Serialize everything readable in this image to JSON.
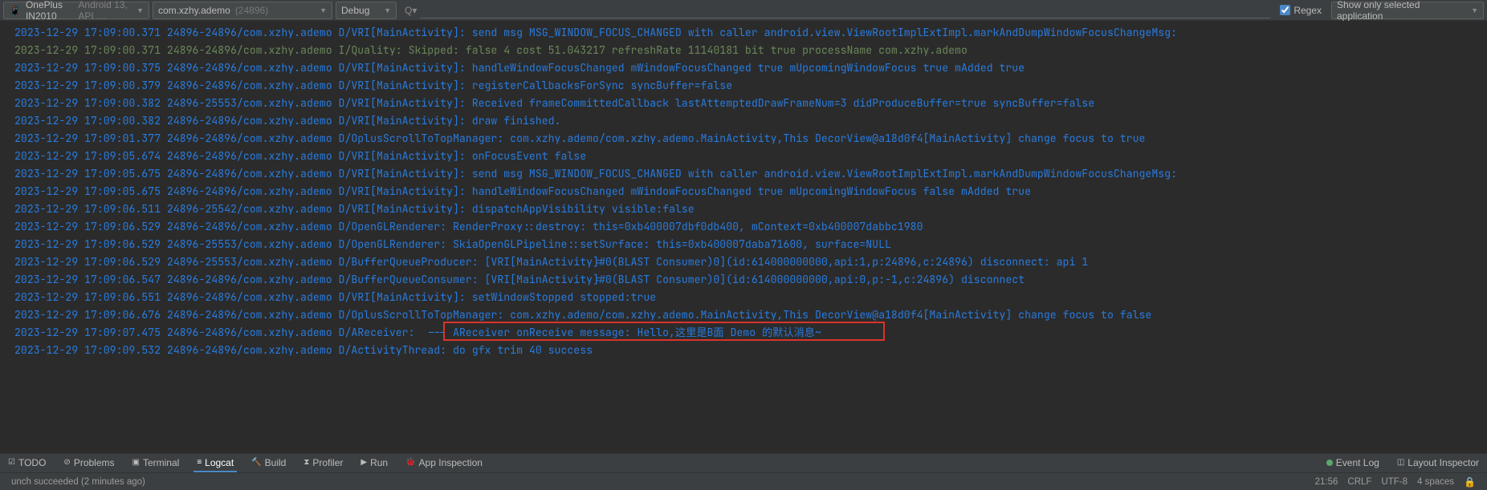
{
  "toolbar": {
    "device": {
      "main": "OnePlus IN2010",
      "extra": "Android 13, API …"
    },
    "process": {
      "main": "com.xzhy.ademo",
      "pid": "(24896)"
    },
    "level": "Debug",
    "search": "",
    "regex_label": "Regex",
    "regex_checked": true,
    "filter": "Show only selected application"
  },
  "logs": [
    {
      "lvl": "D",
      "ts": "2023-12-29 17:09:00.371",
      "pt": "24896-24896",
      "pkg": "com.xzhy.ademo",
      "tag": "VRI[MainActivity]",
      "msg": "send msg MSG_WINDOW_FOCUS_CHANGED with caller android.view.ViewRootImplExtImpl.markAndDumpWindowFocusChangeMsg:"
    },
    {
      "lvl": "I",
      "ts": "2023-12-29 17:09:00.371",
      "pt": "24896-24896",
      "pkg": "com.xzhy.ademo",
      "tag": "Quality",
      "msg": "Skipped: false 4 cost 51.043217 refreshRate 11140181 bit true processName com.xzhy.ademo"
    },
    {
      "lvl": "D",
      "ts": "2023-12-29 17:09:00.375",
      "pt": "24896-24896",
      "pkg": "com.xzhy.ademo",
      "tag": "VRI[MainActivity]",
      "msg": "handleWindowFocusChanged mWindowFocusChanged true mUpcomingWindowFocus true mAdded true"
    },
    {
      "lvl": "D",
      "ts": "2023-12-29 17:09:00.379",
      "pt": "24896-24896",
      "pkg": "com.xzhy.ademo",
      "tag": "VRI[MainActivity]",
      "msg": "registerCallbacksForSync syncBuffer=false"
    },
    {
      "lvl": "D",
      "ts": "2023-12-29 17:09:00.382",
      "pt": "24896-25553",
      "pkg": "com.xzhy.ademo",
      "tag": "VRI[MainActivity]",
      "msg": "Received frameCommittedCallback lastAttemptedDrawFrameNum=3 didProduceBuffer=true syncBuffer=false"
    },
    {
      "lvl": "D",
      "ts": "2023-12-29 17:09:00.382",
      "pt": "24896-24896",
      "pkg": "com.xzhy.ademo",
      "tag": "VRI[MainActivity]",
      "msg": "draw finished."
    },
    {
      "lvl": "D",
      "ts": "2023-12-29 17:09:01.377",
      "pt": "24896-24896",
      "pkg": "com.xzhy.ademo",
      "tag": "OplusScrollToTopManager",
      "msg": "com.xzhy.ademo/com.xzhy.ademo.MainActivity,This DecorView@a18d0f4[MainActivity] change focus to true"
    },
    {
      "lvl": "D",
      "ts": "2023-12-29 17:09:05.674",
      "pt": "24896-24896",
      "pkg": "com.xzhy.ademo",
      "tag": "VRI[MainActivity]",
      "msg": "onFocusEvent false"
    },
    {
      "lvl": "D",
      "ts": "2023-12-29 17:09:05.675",
      "pt": "24896-24896",
      "pkg": "com.xzhy.ademo",
      "tag": "VRI[MainActivity]",
      "msg": "send msg MSG_WINDOW_FOCUS_CHANGED with caller android.view.ViewRootImplExtImpl.markAndDumpWindowFocusChangeMsg:"
    },
    {
      "lvl": "D",
      "ts": "2023-12-29 17:09:05.675",
      "pt": "24896-24896",
      "pkg": "com.xzhy.ademo",
      "tag": "VRI[MainActivity]",
      "msg": "handleWindowFocusChanged mWindowFocusChanged true mUpcomingWindowFocus false mAdded true"
    },
    {
      "lvl": "D",
      "ts": "2023-12-29 17:09:06.511",
      "pt": "24896-25542",
      "pkg": "com.xzhy.ademo",
      "tag": "VRI[MainActivity]",
      "msg": "dispatchAppVisibility visible:false"
    },
    {
      "lvl": "D",
      "ts": "2023-12-29 17:09:06.529",
      "pt": "24896-24896",
      "pkg": "com.xzhy.ademo",
      "tag": "OpenGLRenderer",
      "msg": "RenderProxy::destroy: this=0xb400007dbf0db400, mContext=0xb400007dabbc1980"
    },
    {
      "lvl": "D",
      "ts": "2023-12-29 17:09:06.529",
      "pt": "24896-25553",
      "pkg": "com.xzhy.ademo",
      "tag": "OpenGLRenderer",
      "msg": "SkiaOpenGLPipeline::setSurface: this=0xb400007daba71600, surface=NULL"
    },
    {
      "lvl": "D",
      "ts": "2023-12-29 17:09:06.529",
      "pt": "24896-25553",
      "pkg": "com.xzhy.ademo",
      "tag": "BufferQueueProducer",
      "msg": "[VRI[MainActivity]#0(BLAST Consumer)0](id:614000000000,api:1,p:24896,c:24896) disconnect: api 1"
    },
    {
      "lvl": "D",
      "ts": "2023-12-29 17:09:06.547",
      "pt": "24896-24896",
      "pkg": "com.xzhy.ademo",
      "tag": "BufferQueueConsumer",
      "msg": "[VRI[MainActivity]#0(BLAST Consumer)0](id:614000000000,api:0,p:-1,c:24896) disconnect"
    },
    {
      "lvl": "D",
      "ts": "2023-12-29 17:09:06.551",
      "pt": "24896-24896",
      "pkg": "com.xzhy.ademo",
      "tag": "VRI[MainActivity]",
      "msg": "setWindowStopped stopped:true"
    },
    {
      "lvl": "D",
      "ts": "2023-12-29 17:09:06.676",
      "pt": "24896-24896",
      "pkg": "com.xzhy.ademo",
      "tag": "OplusScrollToTopManager",
      "msg": "com.xzhy.ademo/com.xzhy.ademo.MainActivity,This DecorView@a18d0f4[MainActivity] change focus to false"
    },
    {
      "lvl": "D",
      "ts": "2023-12-29 17:09:07.475",
      "pt": "24896-24896",
      "pkg": "com.xzhy.ademo",
      "tag": "AReceiver",
      "msg": " --- AReceiver onReceive message: Hello,这里是B面 Demo 的默认消息~",
      "hl": true
    },
    {
      "lvl": "D",
      "ts": "2023-12-29 17:09:09.532",
      "pt": "24896-24896",
      "pkg": "com.xzhy.ademo",
      "tag": "ActivityThread",
      "msg": "do gfx trim 40 success"
    }
  ],
  "tool_tabs": {
    "todo": "TODO",
    "problems": "Problems",
    "terminal": "Terminal",
    "logcat": "Logcat",
    "build": "Build",
    "profiler": "Profiler",
    "run": "Run",
    "inspection": "App Inspection",
    "event_log": "Event Log",
    "layout_inspector": "Layout Inspector"
  },
  "status": {
    "msg": "unch succeeded (2 minutes ago)",
    "pos": "21:56",
    "eol": "CRLF",
    "enc": "UTF-8",
    "indent": "4 spaces"
  }
}
